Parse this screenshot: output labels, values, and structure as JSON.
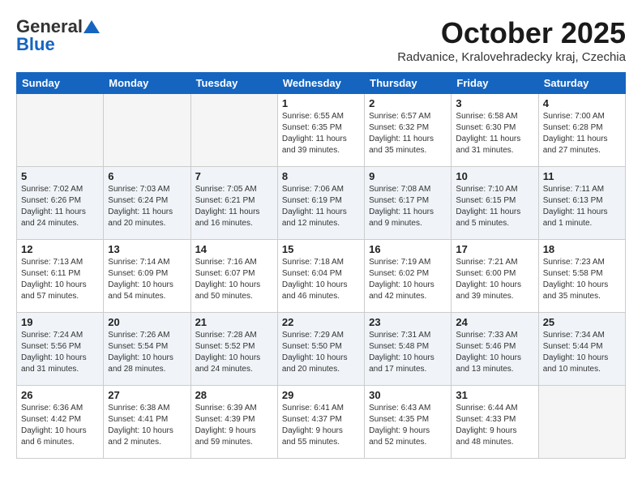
{
  "header": {
    "logo_general": "General",
    "logo_blue": "Blue",
    "month": "October 2025",
    "location": "Radvanice, Kralovehradecky kraj, Czechia"
  },
  "weekdays": [
    "Sunday",
    "Monday",
    "Tuesday",
    "Wednesday",
    "Thursday",
    "Friday",
    "Saturday"
  ],
  "weeks": [
    [
      {
        "day": "",
        "content": ""
      },
      {
        "day": "",
        "content": ""
      },
      {
        "day": "",
        "content": ""
      },
      {
        "day": "1",
        "content": "Sunrise: 6:55 AM\nSunset: 6:35 PM\nDaylight: 11 hours\nand 39 minutes."
      },
      {
        "day": "2",
        "content": "Sunrise: 6:57 AM\nSunset: 6:32 PM\nDaylight: 11 hours\nand 35 minutes."
      },
      {
        "day": "3",
        "content": "Sunrise: 6:58 AM\nSunset: 6:30 PM\nDaylight: 11 hours\nand 31 minutes."
      },
      {
        "day": "4",
        "content": "Sunrise: 7:00 AM\nSunset: 6:28 PM\nDaylight: 11 hours\nand 27 minutes."
      }
    ],
    [
      {
        "day": "5",
        "content": "Sunrise: 7:02 AM\nSunset: 6:26 PM\nDaylight: 11 hours\nand 24 minutes."
      },
      {
        "day": "6",
        "content": "Sunrise: 7:03 AM\nSunset: 6:24 PM\nDaylight: 11 hours\nand 20 minutes."
      },
      {
        "day": "7",
        "content": "Sunrise: 7:05 AM\nSunset: 6:21 PM\nDaylight: 11 hours\nand 16 minutes."
      },
      {
        "day": "8",
        "content": "Sunrise: 7:06 AM\nSunset: 6:19 PM\nDaylight: 11 hours\nand 12 minutes."
      },
      {
        "day": "9",
        "content": "Sunrise: 7:08 AM\nSunset: 6:17 PM\nDaylight: 11 hours\nand 9 minutes."
      },
      {
        "day": "10",
        "content": "Sunrise: 7:10 AM\nSunset: 6:15 PM\nDaylight: 11 hours\nand 5 minutes."
      },
      {
        "day": "11",
        "content": "Sunrise: 7:11 AM\nSunset: 6:13 PM\nDaylight: 11 hours\nand 1 minute."
      }
    ],
    [
      {
        "day": "12",
        "content": "Sunrise: 7:13 AM\nSunset: 6:11 PM\nDaylight: 10 hours\nand 57 minutes."
      },
      {
        "day": "13",
        "content": "Sunrise: 7:14 AM\nSunset: 6:09 PM\nDaylight: 10 hours\nand 54 minutes."
      },
      {
        "day": "14",
        "content": "Sunrise: 7:16 AM\nSunset: 6:07 PM\nDaylight: 10 hours\nand 50 minutes."
      },
      {
        "day": "15",
        "content": "Sunrise: 7:18 AM\nSunset: 6:04 PM\nDaylight: 10 hours\nand 46 minutes."
      },
      {
        "day": "16",
        "content": "Sunrise: 7:19 AM\nSunset: 6:02 PM\nDaylight: 10 hours\nand 42 minutes."
      },
      {
        "day": "17",
        "content": "Sunrise: 7:21 AM\nSunset: 6:00 PM\nDaylight: 10 hours\nand 39 minutes."
      },
      {
        "day": "18",
        "content": "Sunrise: 7:23 AM\nSunset: 5:58 PM\nDaylight: 10 hours\nand 35 minutes."
      }
    ],
    [
      {
        "day": "19",
        "content": "Sunrise: 7:24 AM\nSunset: 5:56 PM\nDaylight: 10 hours\nand 31 minutes."
      },
      {
        "day": "20",
        "content": "Sunrise: 7:26 AM\nSunset: 5:54 PM\nDaylight: 10 hours\nand 28 minutes."
      },
      {
        "day": "21",
        "content": "Sunrise: 7:28 AM\nSunset: 5:52 PM\nDaylight: 10 hours\nand 24 minutes."
      },
      {
        "day": "22",
        "content": "Sunrise: 7:29 AM\nSunset: 5:50 PM\nDaylight: 10 hours\nand 20 minutes."
      },
      {
        "day": "23",
        "content": "Sunrise: 7:31 AM\nSunset: 5:48 PM\nDaylight: 10 hours\nand 17 minutes."
      },
      {
        "day": "24",
        "content": "Sunrise: 7:33 AM\nSunset: 5:46 PM\nDaylight: 10 hours\nand 13 minutes."
      },
      {
        "day": "25",
        "content": "Sunrise: 7:34 AM\nSunset: 5:44 PM\nDaylight: 10 hours\nand 10 minutes."
      }
    ],
    [
      {
        "day": "26",
        "content": "Sunrise: 6:36 AM\nSunset: 4:42 PM\nDaylight: 10 hours\nand 6 minutes."
      },
      {
        "day": "27",
        "content": "Sunrise: 6:38 AM\nSunset: 4:41 PM\nDaylight: 10 hours\nand 2 minutes."
      },
      {
        "day": "28",
        "content": "Sunrise: 6:39 AM\nSunset: 4:39 PM\nDaylight: 9 hours\nand 59 minutes."
      },
      {
        "day": "29",
        "content": "Sunrise: 6:41 AM\nSunset: 4:37 PM\nDaylight: 9 hours\nand 55 minutes."
      },
      {
        "day": "30",
        "content": "Sunrise: 6:43 AM\nSunset: 4:35 PM\nDaylight: 9 hours\nand 52 minutes."
      },
      {
        "day": "31",
        "content": "Sunrise: 6:44 AM\nSunset: 4:33 PM\nDaylight: 9 hours\nand 48 minutes."
      },
      {
        "day": "",
        "content": ""
      }
    ]
  ]
}
